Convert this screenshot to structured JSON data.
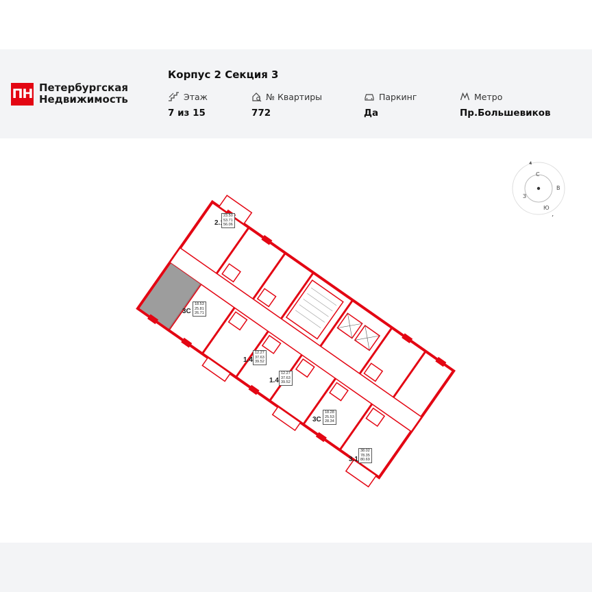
{
  "brand": {
    "mark": "ПН",
    "line1": "Петербургская",
    "line2": "Недвижимость",
    "color": "#e30613"
  },
  "section_title": "Корпус 2 Секция 3",
  "info": {
    "floor": {
      "label": "Этаж",
      "value": "7 из 15",
      "icon": "stairs-icon"
    },
    "apartment": {
      "label": "№ Квартиры",
      "value": "772",
      "icon": "house-key-icon"
    },
    "parking": {
      "label": "Паркинг",
      "value": "Да",
      "icon": "car-icon"
    },
    "metro": {
      "label": "Метро",
      "value": "Пр.Большевиков",
      "icon": "metro-icon"
    }
  },
  "compass": {
    "north": "С",
    "east": "В",
    "south": "Ю",
    "west": "З"
  },
  "plan": {
    "wall_color": "#e30613",
    "highlight_color": "#8c8c8c",
    "apartments": [
      {
        "type": "2.1",
        "areas": [
          "23.50",
          "53.71",
          "56.06"
        ]
      },
      {
        "type": "3С",
        "areas": [
          "18.53",
          "25.81",
          "26.71"
        ],
        "selected": true
      },
      {
        "type": "1.4",
        "areas": [
          "12.27",
          "37.63",
          "39.52"
        ]
      },
      {
        "type": "1.4",
        "areas": [
          "12.27",
          "37.63",
          "39.52"
        ]
      },
      {
        "type": "3С",
        "areas": [
          "18.28",
          "25.53",
          "28.34"
        ]
      },
      {
        "type": "3.1",
        "areas": [
          "38.02",
          "78.35",
          "80.69"
        ]
      }
    ]
  }
}
